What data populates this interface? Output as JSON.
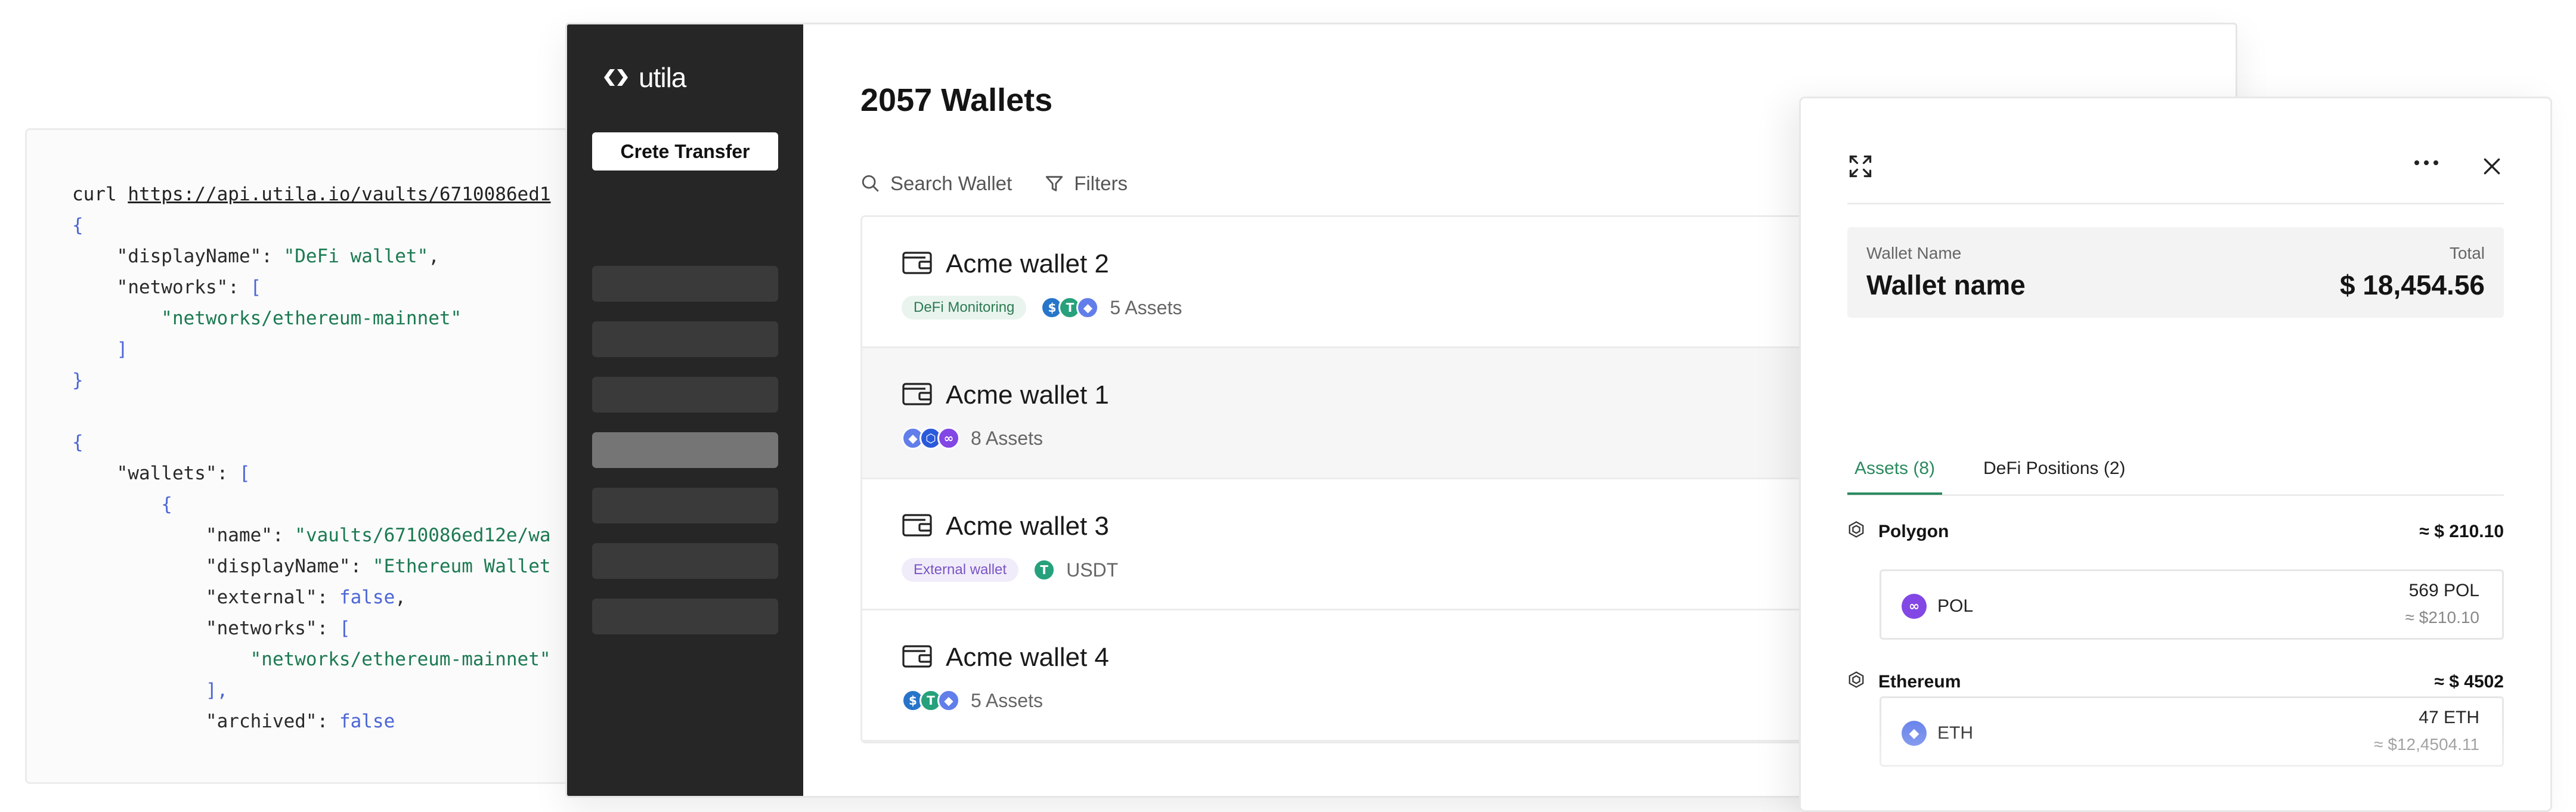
{
  "code": {
    "command": "curl",
    "url": "https://api.utila.io/vaults/6710086ed1",
    "lines": [
      [
        "{"
      ],
      [
        "    \"displayName\"",
        ": ",
        "\"DeFi wallet\"",
        ","
      ],
      [
        "    \"networks\"",
        ": ",
        "["
      ],
      [
        "        \"networks/ethereum-mainnet\""
      ],
      [
        "    ]"
      ],
      [
        "}"
      ],
      [
        ""
      ],
      [
        "{"
      ],
      [
        "    \"wallets\"",
        ": ",
        "["
      ],
      [
        "        {"
      ],
      [
        "            \"name\"",
        ": ",
        "\"vaults/6710086ed12e/wa"
      ],
      [
        "            \"displayName\"",
        ": ",
        "\"Ethereum Wallet"
      ],
      [
        "            \"external\"",
        ": ",
        "false",
        ","
      ],
      [
        "            \"networks\"",
        ": ",
        "["
      ],
      [
        "                \"networks/ethereum-mainnet\""
      ],
      [
        "            ],"
      ],
      [
        "            \"archived\"",
        ": ",
        "false"
      ]
    ]
  },
  "sidebar": {
    "logo_text": "utila",
    "create_button": "Crete Transfer",
    "nav_count": 7,
    "active_index": 3
  },
  "main": {
    "title": "2057 Wallets",
    "search_label": "Search Wallet",
    "filters_label": "Filters",
    "wallets": [
      {
        "name": "Acme wallet 2",
        "tag": "DeFi Monitoring",
        "tag_color": "green",
        "coins": [
          "usdc",
          "usdt",
          "eth"
        ],
        "assets": "5 Assets"
      },
      {
        "name": "Acme wallet 1",
        "tag": "",
        "tag_color": "",
        "coins": [
          "eth",
          "link",
          "pol"
        ],
        "assets": "8 Assets"
      },
      {
        "name": "Acme wallet 3",
        "tag": "External wallet",
        "tag_color": "purple",
        "coins": [
          "usdt"
        ],
        "assets": "USDT"
      },
      {
        "name": "Acme wallet 4",
        "tag": "",
        "tag_color": "",
        "coins": [
          "usdc",
          "usdt",
          "eth"
        ],
        "assets": "5 Assets"
      }
    ]
  },
  "detail": {
    "wallet_name_label": "Wallet Name",
    "wallet_name": "Wallet name",
    "total_label": "Total",
    "total_value": "$ 18,454.56",
    "tabs": [
      "Assets (8)",
      "DeFi Positions (2)"
    ],
    "networks": [
      {
        "name": "Polygon",
        "value": "≈ $ 210.10",
        "asset": {
          "symbol": "POL",
          "coin": "pol",
          "amount": "569 POL",
          "usd": "≈ $210.10"
        }
      },
      {
        "name": "Ethereum",
        "value": "≈ $ 4502",
        "asset": {
          "symbol": "ETH",
          "coin": "eth",
          "amount": "47 ETH",
          "usd": "≈ $12,4504.11"
        }
      }
    ]
  },
  "colors": {
    "accent": "#2b8a5f",
    "sidebar_bg": "#262626",
    "usdc": "#2775ca",
    "usdt": "#26a17b",
    "eth": "#627eea",
    "pol": "#8247e5",
    "link": "#2a5ada"
  },
  "icons": [
    "wallet-icon",
    "search-icon",
    "filter-icon",
    "expand-icon",
    "more-icon",
    "close-icon",
    "network-icon"
  ]
}
